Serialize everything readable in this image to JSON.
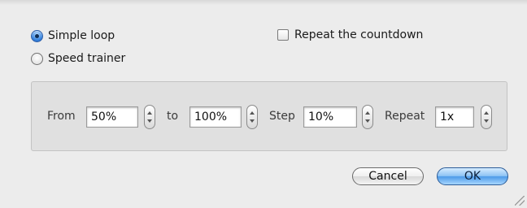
{
  "mode": {
    "simple_loop_label": "Simple loop",
    "speed_trainer_label": "Speed trainer",
    "selected": "simple_loop"
  },
  "repeat_countdown": {
    "label": "Repeat the countdown",
    "checked": false
  },
  "speed": {
    "from_label": "From",
    "from_value": "50%",
    "to_label": "to",
    "to_value": "100%",
    "step_label": "Step",
    "step_value": "10%",
    "repeat_label": "Repeat",
    "repeat_value": "1x"
  },
  "buttons": {
    "cancel": "Cancel",
    "ok": "OK"
  }
}
